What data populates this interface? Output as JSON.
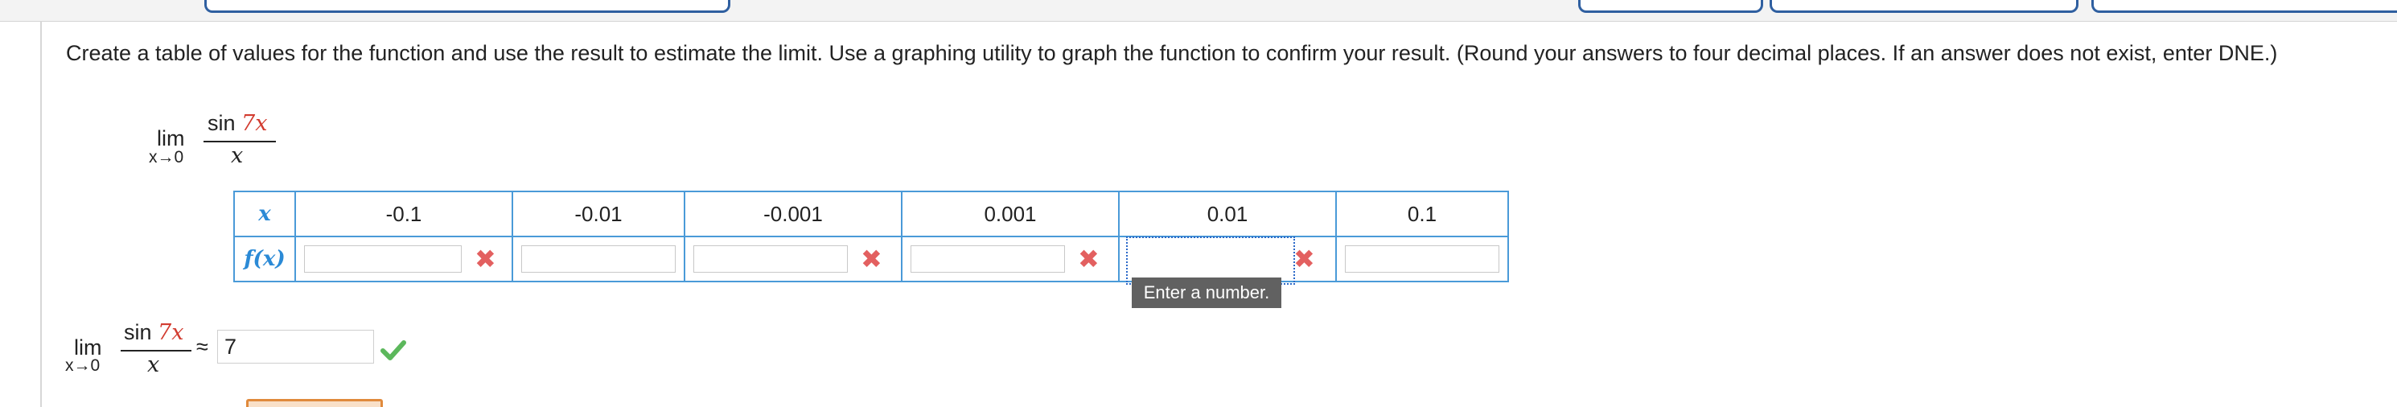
{
  "instructions": "Create a table of values for the function and use the result to estimate the limit. Use a graphing utility to graph the function to confirm your result. (Round your answers to four decimal places. If an answer does not exist, enter DNE.)",
  "limit": {
    "lim": "lim",
    "approach": "x→0",
    "numerator_prefix": "sin ",
    "numerator_arg": "7x",
    "denominator": "x"
  },
  "table": {
    "x_label": "x",
    "fx_label": "f(x)",
    "x_values": [
      "-0.1",
      "-0.01",
      "-0.001",
      "0.001",
      "0.01",
      "0.1"
    ],
    "fx_values": [
      "",
      "",
      "",
      "",
      "",
      ""
    ],
    "fx_status": [
      "incorrect",
      "none",
      "incorrect",
      "incorrect",
      "incorrect",
      "none"
    ]
  },
  "tooltip": "Enter a number.",
  "answer": {
    "approx_symbol": "≈",
    "value": "7",
    "status": "correct"
  },
  "colors": {
    "table_border": "#4a9ad8",
    "incorrect": "#e36060",
    "correct": "#5cb85c",
    "accent_red": "#d23b2f"
  }
}
